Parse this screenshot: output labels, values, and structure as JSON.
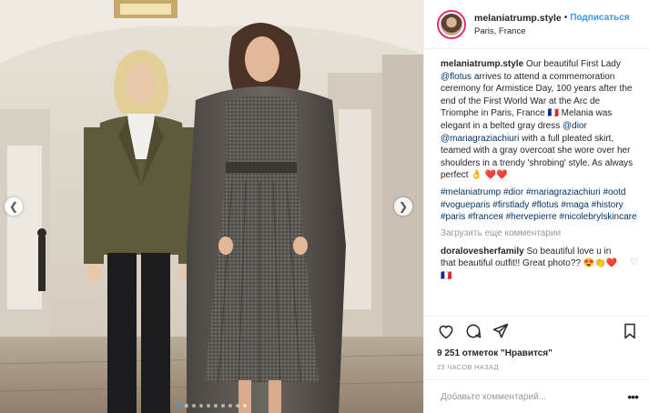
{
  "post": {
    "username": "melaniatrump.style",
    "follow_label": "Подписаться",
    "separator": "•",
    "location": "Paris, France",
    "caption_user": "melaniatrump.style",
    "caption_text_1": " Our beautiful First Lady ",
    "caption_mention_1": "@flotus",
    "caption_text_2": " arrives to attend a commemoration ceremony for Armistice Day, 100 years after the end of the First World War at the Arc de Triomphe in Paris, France 🇫🇷 Melania was elegant in a belted gray dress ",
    "caption_mention_2": "@dior",
    "caption_mention_3": "@mariagraziachiuri",
    "caption_text_3": " with a full pleated skirt, teamed with a gray overcoat she wore over her shoulders in a trendy 'shrobing' style. As always perfect 👌 ❤️❤️",
    "hashtags": [
      "#melaniatrump",
      "#dior",
      "#mariagraziachiuri",
      "#ootd",
      "#vogueparis",
      "#firstlady",
      "#flotus",
      "#maga",
      "#history",
      "#paris",
      "#franceя",
      "#hervepierre",
      "#nicolebrylskincare"
    ],
    "load_more_label": "Загрузить еще комментарии",
    "comments": [
      {
        "user": "doralovesherfamily",
        "text": " So beautiful love u in that beautiful outfit!! Great photo?? 😍👏❤️🇫🇷"
      }
    ],
    "likes_label": "9 251 отметок \"Нравится\"",
    "time_label": "23 ЧАСОВ НАЗАД",
    "comment_placeholder": "Добавьте комментарий...",
    "more_label": "•••",
    "carousel_count": 10,
    "carousel_active_index": 0
  },
  "icons": {
    "like": "heart-icon",
    "comment": "comment-icon",
    "share": "share-icon",
    "save": "bookmark-icon",
    "prev": "chevron-left-icon",
    "next": "chevron-right-icon"
  },
  "colors": {
    "link_blue": "#3897f0",
    "mention": "#003569",
    "muted": "#999999",
    "border": "#efefef"
  }
}
